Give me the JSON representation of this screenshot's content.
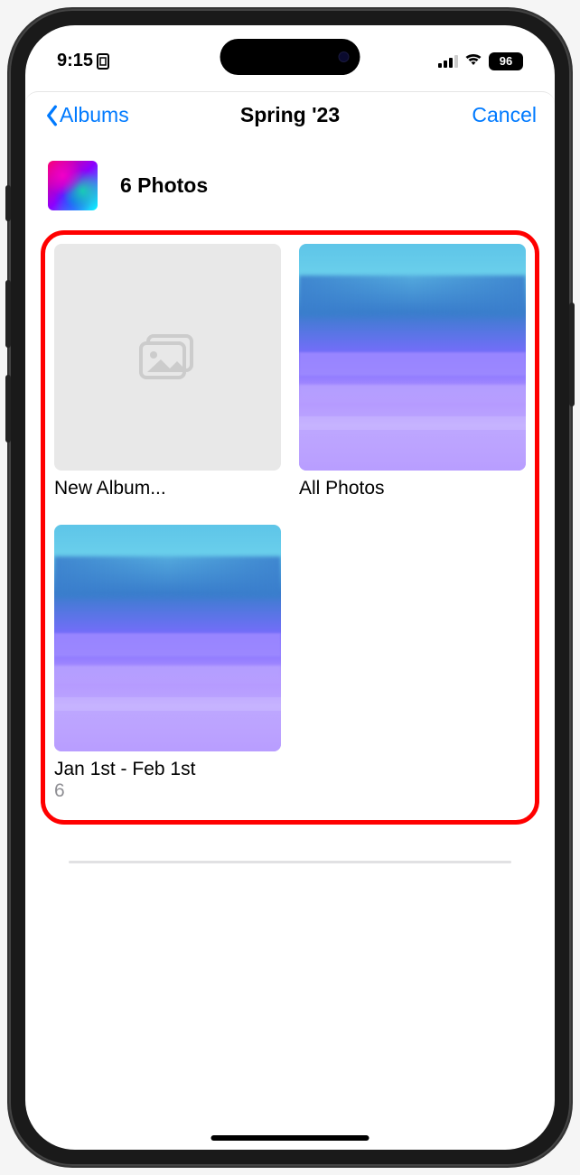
{
  "statusBar": {
    "time": "9:15",
    "batteryPercent": "96"
  },
  "nav": {
    "backLabel": "Albums",
    "title": "Spring '23",
    "cancelLabel": "Cancel"
  },
  "selection": {
    "countLabel": "6 Photos"
  },
  "albums": [
    {
      "label": "New Album...",
      "sub": "",
      "coverType": "placeholder"
    },
    {
      "label": "All Photos",
      "sub": "",
      "coverType": "sky"
    },
    {
      "label": "Jan 1st - Feb 1st",
      "sub": "6",
      "coverType": "sky"
    }
  ]
}
